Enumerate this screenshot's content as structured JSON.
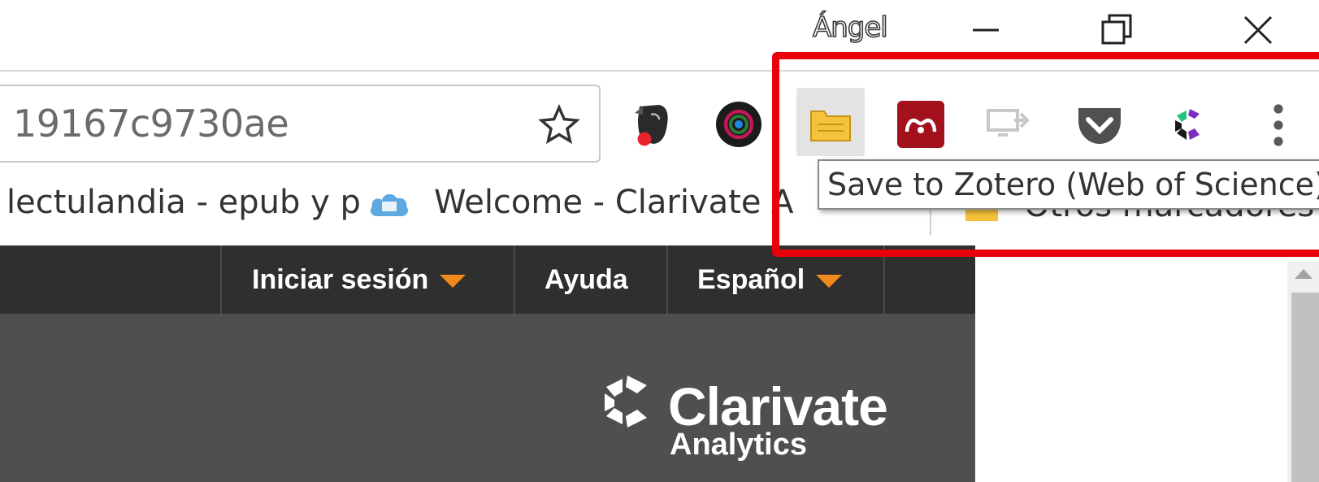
{
  "window": {
    "profile_name": "Ángel",
    "icons": [
      "minimize-icon",
      "restore-icon",
      "close-icon"
    ]
  },
  "omnibox": {
    "url_fragment": "19167c9730ae"
  },
  "extensions": [
    {
      "name": "evernote-icon"
    },
    {
      "name": "camera-lens-icon"
    },
    {
      "name": "zotero-folder-icon"
    },
    {
      "name": "mendeley-icon"
    },
    {
      "name": "cast-icon"
    },
    {
      "name": "pocket-icon"
    },
    {
      "name": "clarivate-extension-icon"
    },
    {
      "name": "chrome-menu-icon"
    }
  ],
  "tooltip": {
    "text": "Save to Zotero (Web of Science)"
  },
  "bookmarks": {
    "item1": "lectulandia - epub y p",
    "item2": "Welcome - Clarivate A",
    "other": "Otros marcadores"
  },
  "site_nav": {
    "signin": "Iniciar sesión",
    "help": "Ayuda",
    "language": "Español"
  },
  "logo": {
    "name": "Clarivate",
    "sub": "Analytics"
  },
  "colors": {
    "highlight": "#e8000b",
    "nav_bg": "#2f2f2f",
    "hero_bg": "#4f4f4f",
    "caret": "#f08a1c",
    "zotero": "#f5c33b",
    "mendeley": "#a3111c"
  }
}
